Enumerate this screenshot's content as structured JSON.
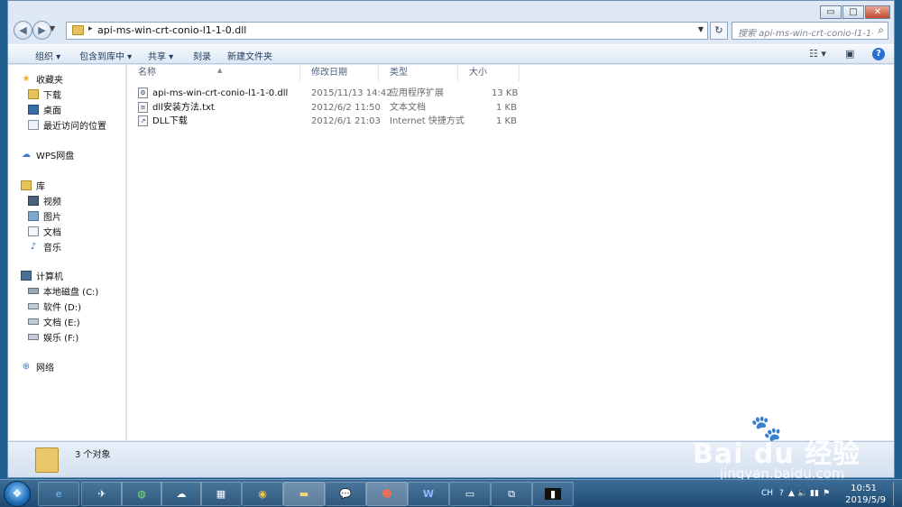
{
  "window": {
    "controls": {
      "minimize": "▭",
      "maximize": "□",
      "close": "✕"
    }
  },
  "address": {
    "path": "api-ms-win-crt-conio-l1-1-0.dll",
    "search_placeholder": "搜索 api-ms-win-crt-conio-l1-1-0.dll"
  },
  "toolbar": {
    "organize": "组织 ▾",
    "include_in_library": "包含到库中 ▾",
    "share": "共享 ▾",
    "burn": "刻录",
    "new_folder": "新建文件夹"
  },
  "nav": {
    "favorites": {
      "label": "收藏夹",
      "items": [
        "下载",
        "桌面",
        "最近访问的位置"
      ]
    },
    "wps": "WPS网盘",
    "libraries": {
      "label": "库",
      "items": [
        "视频",
        "图片",
        "文档",
        "音乐"
      ]
    },
    "computer": {
      "label": "计算机",
      "items": [
        "本地磁盘 (C:)",
        "软件 (D:)",
        "文档 (E:)",
        "娱乐 (F:)"
      ]
    },
    "network": "网络"
  },
  "columns": {
    "name": "名称",
    "modified": "修改日期",
    "type": "类型",
    "size": "大小"
  },
  "files": [
    {
      "name": "api-ms-win-crt-conio-l1-1-0.dll",
      "modified": "2015/11/13 14:42",
      "type": "应用程序扩展",
      "size": "13 KB",
      "icon": "dll-file-icon"
    },
    {
      "name": "dll安装方法.txt",
      "modified": "2012/6/2 11:50",
      "type": "文本文档",
      "size": "1 KB",
      "icon": "text-file-icon"
    },
    {
      "name": "DLL下载",
      "modified": "2012/6/1 21:03",
      "type": "Internet 快捷方式",
      "size": "1 KB",
      "icon": "shortcut-icon"
    }
  ],
  "status": {
    "count": "3 个对象"
  },
  "watermark": {
    "brand": "Bai du 经验",
    "url": "jingyan.baidu.com"
  },
  "taskbar": {
    "tray": {
      "lang": "CH",
      "time": "10:51",
      "date": "2019/5/9"
    }
  }
}
